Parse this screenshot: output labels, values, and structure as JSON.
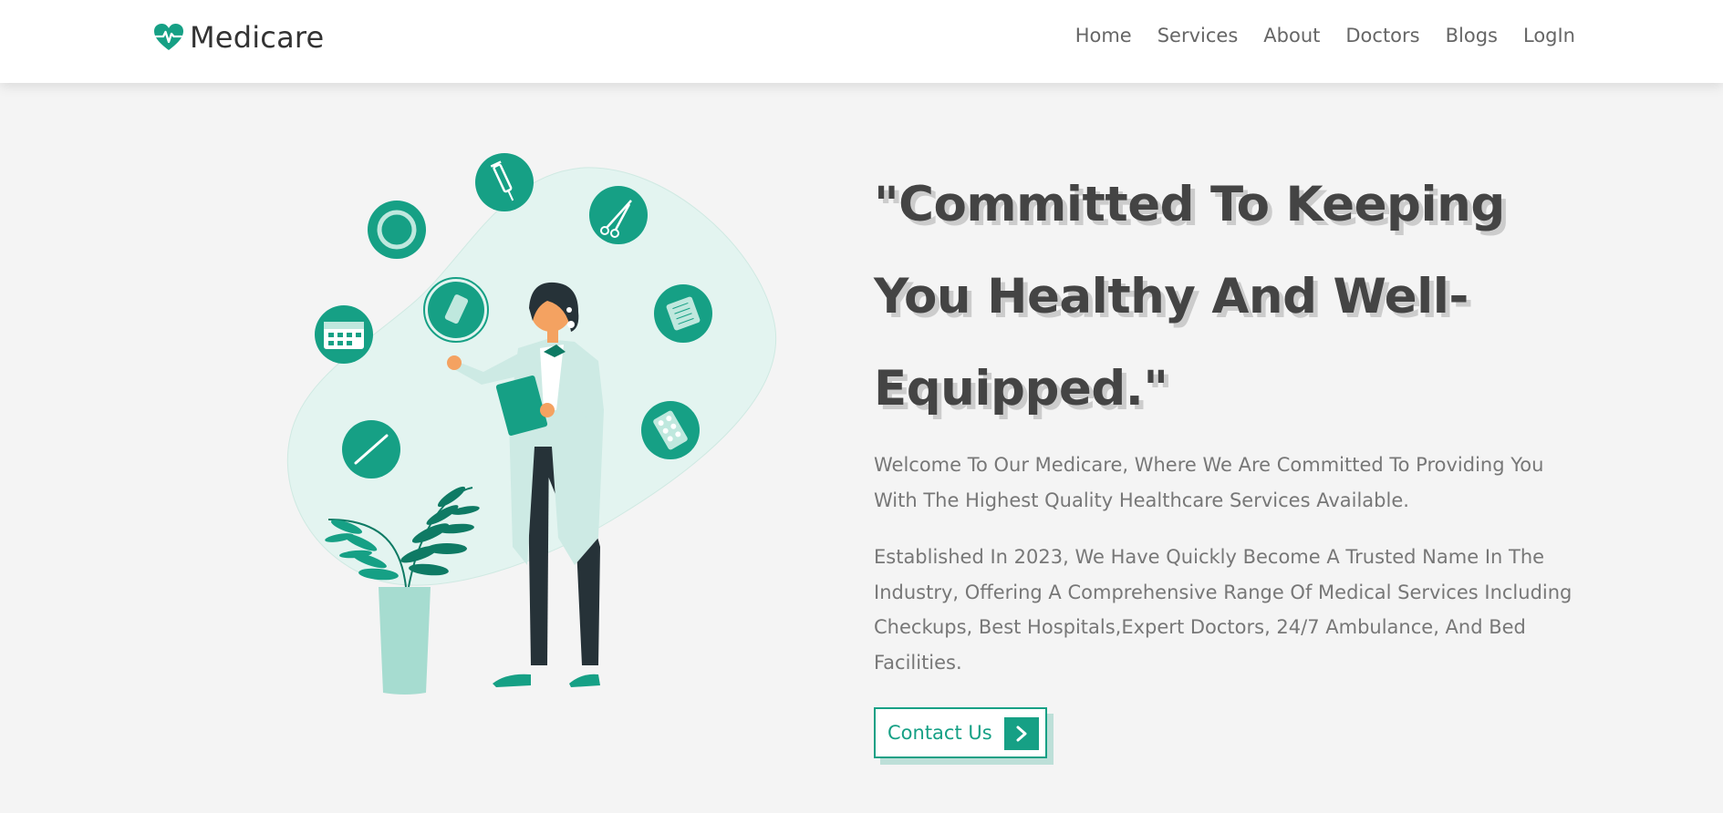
{
  "brand": {
    "name": "Medicare",
    "accent_color": "#16a085"
  },
  "nav": {
    "items": [
      {
        "label": "Home"
      },
      {
        "label": "Services"
      },
      {
        "label": "About"
      },
      {
        "label": "Doctors"
      },
      {
        "label": "Blogs"
      },
      {
        "label": "LogIn"
      }
    ]
  },
  "hero": {
    "heading": "\"Committed To Keeping You Healthy And Well-Equipped.\"",
    "paragraph1": "Welcome To Our Medicare, Where We Are Committed To Providing You With The Highest Quality Healthcare Services Available.",
    "paragraph2": "Established In 2023, We Have Quickly Become A Trusted Name In The Industry, Offering A Comprehensive Range Of Medical Services Including Checkups, Best Hospitals,Expert Doctors, 24/7 Ambulance, And Bed Facilities.",
    "cta_label": "Contact Us",
    "cta_icon": "chevron-right-icon"
  },
  "illustration": {
    "icons": [
      "syringe-icon",
      "ring-icon",
      "scissors-icon",
      "spray-icon",
      "bandage-icon",
      "calendar-icon",
      "pill-pack-icon",
      "thermometer-icon"
    ]
  }
}
